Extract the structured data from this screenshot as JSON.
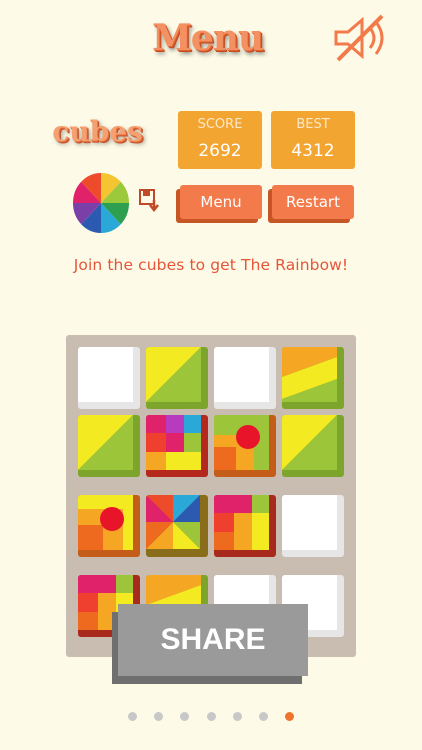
{
  "header": {
    "title": "Menu",
    "mute_icon": "speaker-muted-icon"
  },
  "logo": {
    "text": "cubes"
  },
  "scoreboard": {
    "score_label": "SCORE",
    "score_value": "2692",
    "best_label": "BEST",
    "best_value": "4312"
  },
  "buttons": {
    "menu_label": "Menu",
    "restart_label": "Restart",
    "share_label": "SHARE"
  },
  "tagline": "Join the cubes to get The Rainbow!",
  "board": {
    "rows": 4,
    "cols": 4,
    "tiles": [
      "empty",
      "yellow-green",
      "empty",
      "orange-yellow",
      "yellow-green",
      "multicolor-red",
      "green-red-dot",
      "yellow-green",
      "orange-red-dot",
      "rainbow",
      "multicolor-pink",
      "empty",
      "multicolor-pink",
      "orange-yellow",
      "empty",
      "empty"
    ]
  },
  "pagination": {
    "total": 7,
    "active_index": 6
  },
  "colors": {
    "background": "#fdfbe7",
    "accent": "#f27a4b",
    "score_box": "#f3a531",
    "tagline": "#e5553a"
  }
}
